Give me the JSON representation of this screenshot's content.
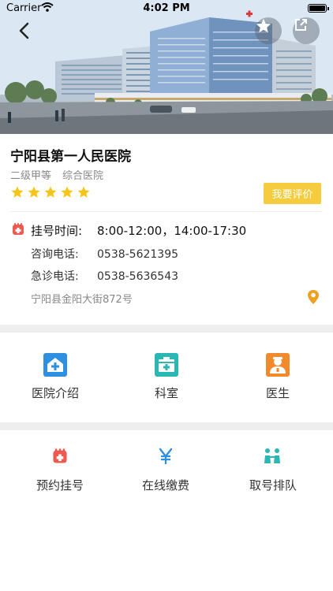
{
  "status_bar": {
    "carrier": "Carrier",
    "time": "4:02 PM"
  },
  "hospital": {
    "name": "宁阳县第一人民医院",
    "level": "二级甲等",
    "type": "综合医院",
    "rating": 5,
    "review_button": "我要评价",
    "hours_label": "挂号时间:",
    "hours_value": "8:00-12:00，14:00-17:30",
    "consult_label": "咨询电话:",
    "consult_phone": "0538-5621395",
    "emergency_label": "急诊电话:",
    "emergency_phone": "0538-5636543",
    "address": "宁阳县金阳大街872号"
  },
  "colors": {
    "star": "#f5c518",
    "accent_yellow": "#f6cc3f",
    "blue": "#2f8fe0",
    "teal": "#2bb8b5",
    "orange": "#f08a2c",
    "red": "#ef5a50",
    "divider": "#eeeeee"
  },
  "primary_menu": [
    {
      "label": "医院介绍",
      "icon": "hospital-info-icon"
    },
    {
      "label": "科室",
      "icon": "department-icon"
    },
    {
      "label": "医生",
      "icon": "doctor-icon"
    }
  ],
  "service_menu": [
    {
      "label": "预约挂号",
      "icon": "appointment-icon"
    },
    {
      "label": "在线缴费",
      "icon": "payment-icon"
    },
    {
      "label": "取号排队",
      "icon": "queue-icon"
    }
  ]
}
